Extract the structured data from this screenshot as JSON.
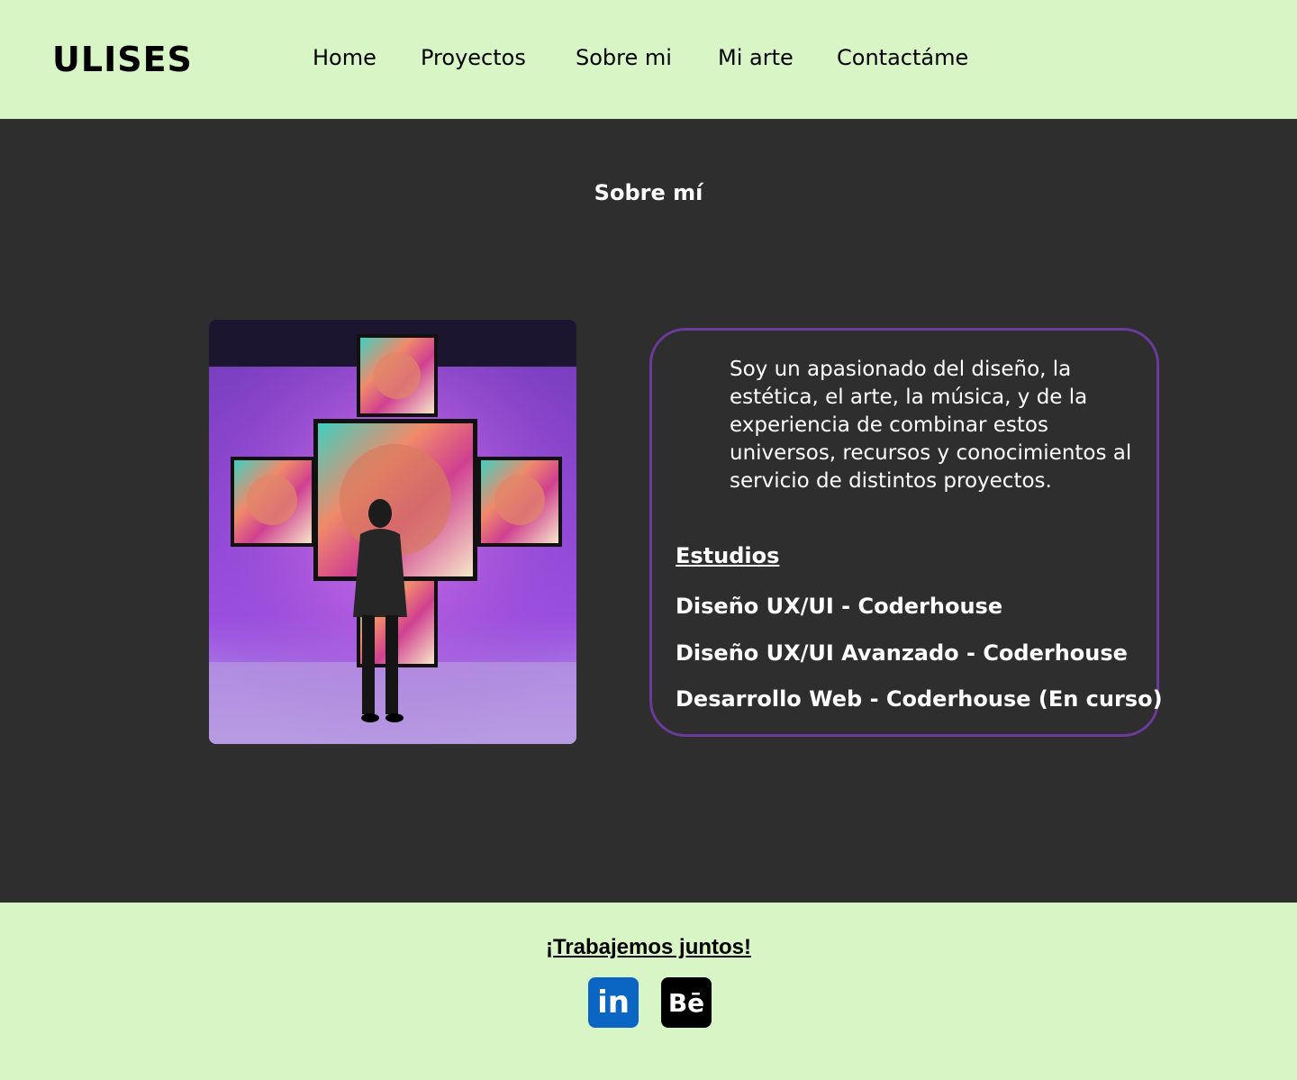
{
  "header": {
    "logo": "ULISES",
    "nav": [
      "Home",
      "Proyectos",
      "Sobre mi",
      "Mi arte",
      "Contactáme"
    ]
  },
  "main": {
    "title": "Sobre mí",
    "bio": "Soy un apasionado del diseño, la estética, el arte, la música, y de la experiencia de combinar estos universos, recursos y conocimientos al servicio de distintos proyectos.",
    "studies_heading": "Estudios",
    "studies": [
      "Diseño UX/UI - Coderhouse",
      "Diseño UX/UI Avanzado - Coderhouse",
      "Desarrollo Web - Coderhouse (En curso)"
    ]
  },
  "footer": {
    "cta": "¡Trabajemos juntos!",
    "social": [
      {
        "icon": "linkedin-icon",
        "glyph": "in"
      },
      {
        "icon": "behance-icon",
        "glyph": "Bē"
      }
    ]
  },
  "colors": {
    "header_bg": "#d8f5c6",
    "main_bg": "#2e2e2e",
    "box_border": "#6b3a9a",
    "linkedin": "#0a66c2"
  }
}
